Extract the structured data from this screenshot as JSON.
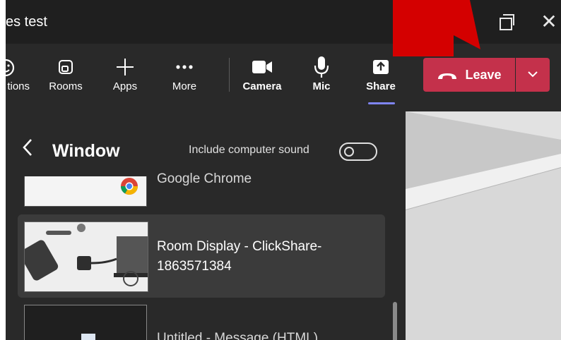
{
  "window": {
    "title": "es test",
    "minimize_icon": "minimize-icon",
    "maximize_icon": "restore-icon",
    "close_icon": "close-icon"
  },
  "toolbar": {
    "reactions_label": "tions",
    "rooms_label": "Rooms",
    "apps_label": "Apps",
    "more_label": "More",
    "camera_label": "Camera",
    "mic_label": "Mic",
    "share_label": "Share",
    "selected": "Share",
    "accent_color": "#7f85f5"
  },
  "leave": {
    "label": "Leave",
    "color": "#c4314b",
    "icon": "hang-up-phone-icon",
    "menu_icon": "chevron-down-icon"
  },
  "share_panel": {
    "back_icon": "chevron-left-icon",
    "title": "Window",
    "include_sound_label": "Include computer sound",
    "include_sound_on": false,
    "items": [
      {
        "label": "Google Chrome",
        "icon": "chrome-icon"
      },
      {
        "label": "Room Display - ClickShare-1863571384",
        "selected": true
      },
      {
        "label": "Untitled - Message (HTML)"
      }
    ]
  },
  "annotation": {
    "color": "#d40000",
    "shape": "arrow"
  }
}
